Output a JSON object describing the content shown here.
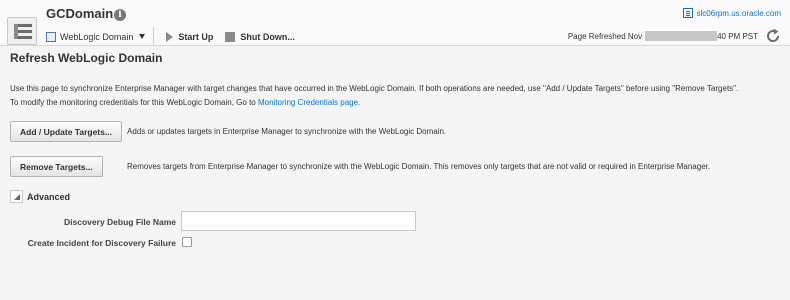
{
  "header": {
    "title": "GCDomain",
    "info_icon": "info-icon",
    "host": "slc06rpm.us.oracle.com",
    "host_icon": "host-icon"
  },
  "toolbar": {
    "target_menu_label": "WebLogic Domain",
    "startup_label": "Start Up",
    "shutdown_label": "Shut Down...",
    "refresh_prefix": "Page Refreshed Nov",
    "refresh_suffix": "40 PM PST",
    "refresh_icon": "refresh-icon"
  },
  "main": {
    "title": "Refresh WebLogic Domain",
    "description_line1": "Use this page to synchronize Enterprise Manager with target changes that have occurred in the WebLogic Domain. If both operations are needed, use \"Add / Update Targets\" before using \"Remove Targets\".",
    "description_line2_prefix": "To modify the monitoring credentials for this WebLogic Domain, Go to",
    "credentials_link": "Monitoring Credentials page.",
    "add_update_button": "Add / Update Targets...",
    "add_update_desc": "Adds or updates targets in Enterprise Manager to synchronize with the WebLogic Domain.",
    "remove_button": "Remove Targets...",
    "remove_desc": "Removes targets from Enterprise Manager to synchronize with the WebLogic Domain. This removes only targets that are not valid or required in Enterprise Manager.",
    "advanced_label": "Advanced",
    "debug_file_label": "Discovery Debug File Name",
    "debug_file_value": "",
    "incident_label": "Create Incident for Discovery Failure",
    "incident_checked": false
  },
  "colors": {
    "link": "#0572ce",
    "background": "#f5f5f5"
  }
}
